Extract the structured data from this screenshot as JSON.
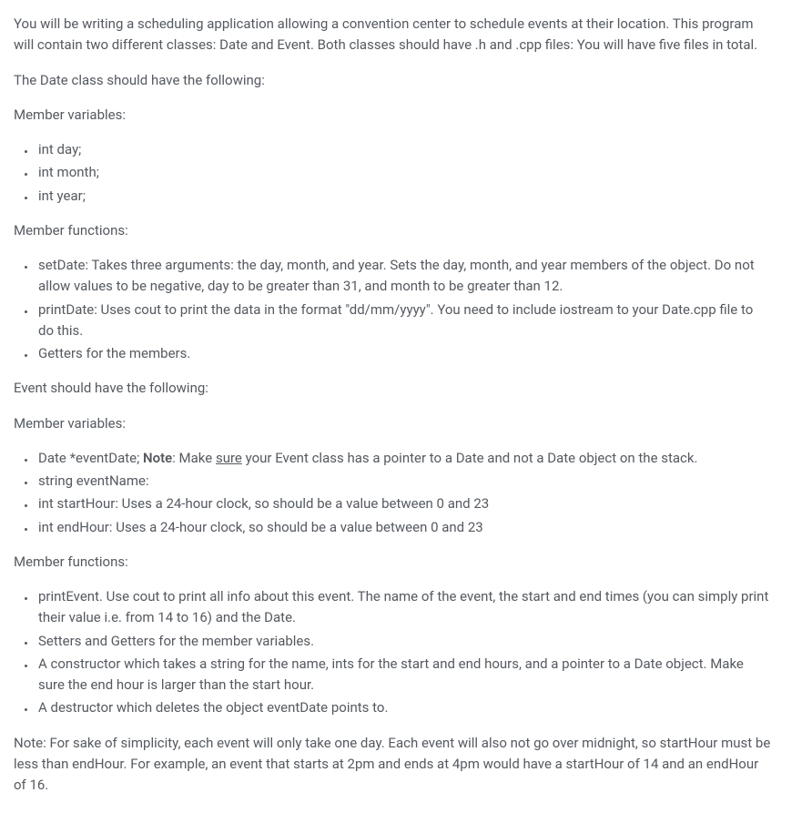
{
  "intro": "You will be writing a scheduling application allowing a convention center to schedule events at their location. This program will contain two different classes: Date and Event. Both classes should have .h and .cpp files: You will have five files in total.",
  "date_heading": "The Date class should have the following:",
  "member_vars_label": "Member variables:",
  "date_vars": {
    "v0": "int day;",
    "v1": "int month;",
    "v2": "int year;"
  },
  "member_funcs_label": "Member functions:",
  "date_funcs": {
    "f0": "setDate: Takes three arguments: the day, month, and year. Sets the day, month, and year members of the object. Do not allow values to be negative, day to be greater than 31, and month to be greater than 12.",
    "f1": "printDate: Uses cout to print the data in the format \"dd/mm/yyyy\". You need to include iostream to your Date.cpp file to do this.",
    "f2": "Getters for the members."
  },
  "event_heading": "Event should have the following:",
  "event_vars": {
    "v0_prefix": "Date *eventDate; ",
    "v0_note_label": "Note",
    "v0_mid": ": Make ",
    "v0_sure": "sure",
    "v0_suffix": " your Event class has a pointer to a Date and not a Date object on the stack.",
    "v1": "string eventName:",
    "v2": "int startHour: Uses a 24-hour clock, so should be a value between 0 and 23",
    "v3": "int endHour: Uses a 24-hour clock, so should be a value between 0 and 23"
  },
  "event_funcs": {
    "f0": "printEvent. Use cout to print all info about this event. The name of the event, the start and end times (you can simply print their value i.e. from 14 to 16) and the Date.",
    "f1": "Setters and Getters for the member variables.",
    "f2": "A constructor which takes a string for the name, ints for the start and end hours, and a pointer to a Date object. Make sure the end hour is larger than the start hour.",
    "f3": "A destructor which deletes the object eventDate points to."
  },
  "note_final": "Note: For sake of simplicity, each event will only take one day. Each event will also not go over midnight, so startHour must be less than endHour. For example, an event that starts at 2pm and ends at 4pm would have a startHour of 14 and an endHour of 16."
}
